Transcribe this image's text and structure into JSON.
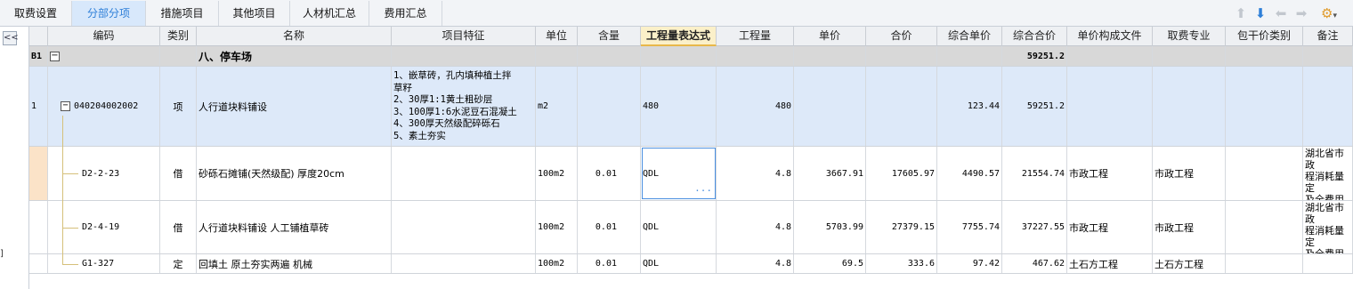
{
  "tabs": [
    {
      "label": "取费设置",
      "active": false
    },
    {
      "label": "分部分项",
      "active": true
    },
    {
      "label": "措施项目",
      "active": false
    },
    {
      "label": "其他项目",
      "active": false
    },
    {
      "label": "人材机汇总",
      "active": false
    },
    {
      "label": "费用汇总",
      "active": false
    }
  ],
  "toolbar": {
    "icons": [
      "arrow-up-icon",
      "arrow-down-icon",
      "arrow-left-icon",
      "arrow-right-icon",
      "settings-dropdown-icon"
    ],
    "collapse_label": "<<",
    "edge_mark": "]"
  },
  "columns": {
    "code": "编码",
    "type": "类别",
    "name": "名称",
    "feature": "项目特征",
    "unit": "单位",
    "content": "含量",
    "expr": "工程量表达式",
    "qty": "工程量",
    "price": "单价",
    "total": "合价",
    "comp_price": "综合单价",
    "comp_total": "综合合价",
    "price_file": "单价构成文件",
    "fee_major": "取费专业",
    "pkg_type": "包干价类别",
    "remark": "备注"
  },
  "rows": {
    "section": {
      "num": "B1",
      "name": "八、停车场",
      "comp_total": "59251.2"
    },
    "item": {
      "num": "1",
      "code": "040204002002",
      "type": "项",
      "name": "人行道块料铺设",
      "feature": "1、嵌草砖，孔内填种植土拌\n草籽\n2、30厚1:1黄土粗砂层\n3、100厚1:6水泥豆石混凝土\n4、300厚天然级配碎砾石\n5、素土夯实",
      "unit": "m2",
      "expr": "480",
      "qty": "480",
      "comp_price": "123.44",
      "comp_total": "59251.2"
    },
    "subs": [
      {
        "code": "D2-2-23",
        "type": "借",
        "name": "砂砾石摊铺(天然级配) 厚度20cm",
        "unit": "100m2",
        "content": "0.01",
        "expr": "QDL",
        "qty": "4.8",
        "price": "3667.91",
        "total": "17605.97",
        "comp_price": "4490.57",
        "comp_total": "21554.74",
        "price_file": "市政工程",
        "fee_major": "市政工程",
        "remark": "湖北省市政\n程消耗量定\n及全费用基\n表(2018)"
      },
      {
        "code": "D2-4-19",
        "type": "借",
        "name": "人行道块料铺设 人工铺植草砖",
        "unit": "100m2",
        "content": "0.01",
        "expr": "QDL",
        "qty": "4.8",
        "price": "5703.99",
        "total": "27379.15",
        "comp_price": "7755.74",
        "comp_total": "37227.55",
        "price_file": "市政工程",
        "fee_major": "市政工程",
        "remark": "湖北省市政\n程消耗量定\n及全费用基\n表(2018)"
      },
      {
        "code": "G1-327",
        "type": "定",
        "name": "回填土 原土夯实两遍 机械",
        "unit": "100m2",
        "content": "0.01",
        "expr": "QDL",
        "qty": "4.8",
        "price": "69.5",
        "total": "333.6",
        "comp_price": "97.42",
        "comp_total": "467.62",
        "price_file": "土石方工程",
        "fee_major": "土石方工程",
        "remark": ""
      }
    ],
    "ellipsis": "···"
  },
  "colors": {
    "active_tab": "#2e7fd8",
    "main_row": "#dde9f9",
    "section_row": "#d8d8d8",
    "highlight_header": "#fbf0c9",
    "tree_line": "#d5c07a"
  }
}
